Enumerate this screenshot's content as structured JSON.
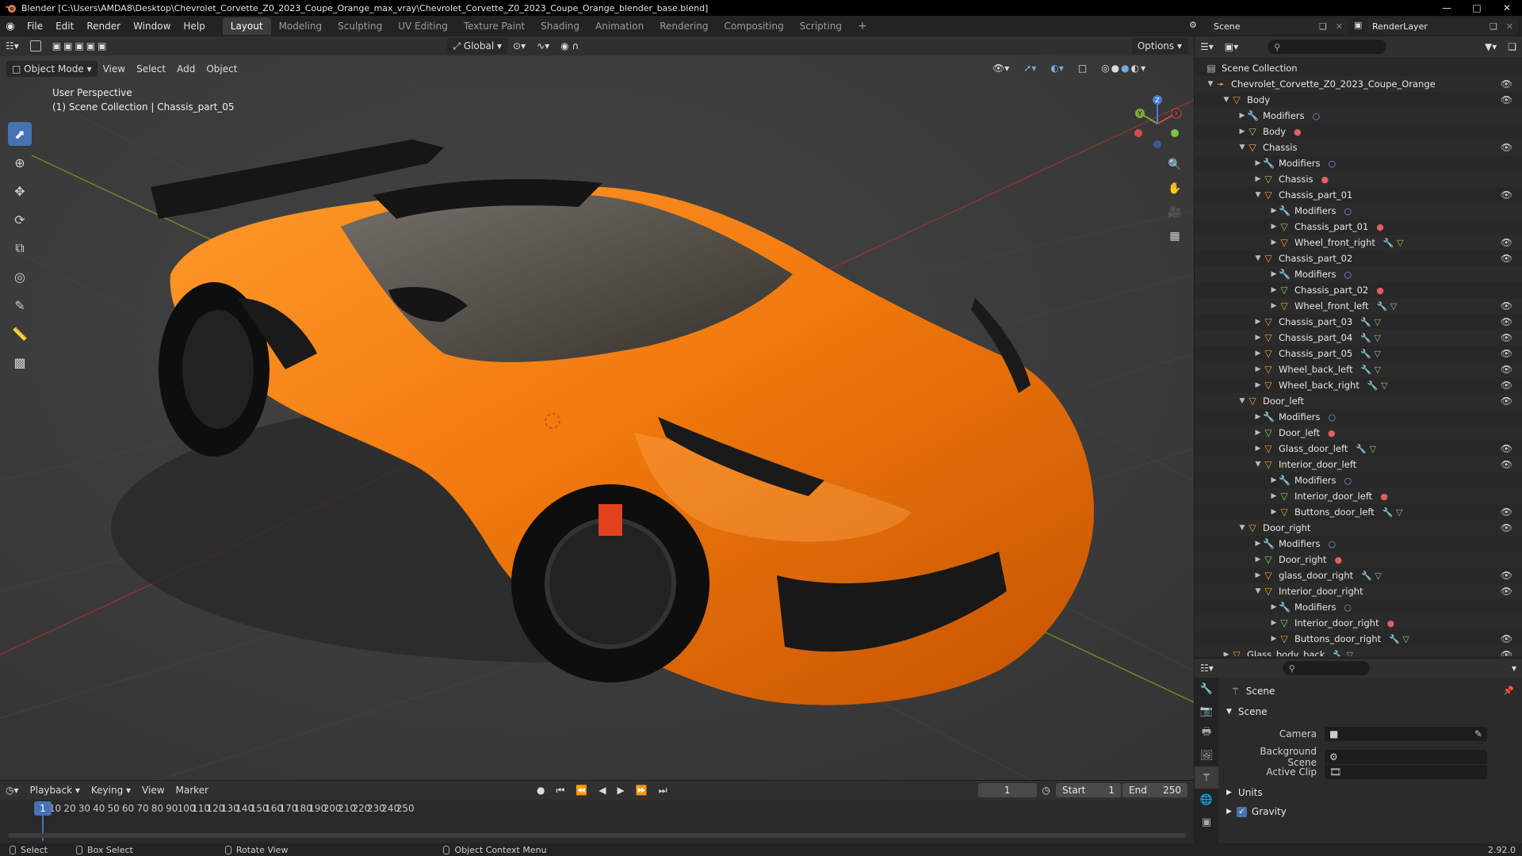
{
  "window": {
    "title": "Blender [C:\\Users\\AMDA8\\Desktop\\Chevrolet_Corvette_Z0_2023_Coupe_Orange_max_vray\\Chevrolet_Corvette_Z0_2023_Coupe_Orange_blender_base.blend]",
    "min_icon": "minimize-icon",
    "max_icon": "maximize-icon",
    "close_icon": "close-icon"
  },
  "menubar": {
    "items": [
      "File",
      "Edit",
      "Render",
      "Window",
      "Help"
    ]
  },
  "workspaces": [
    "Layout",
    "Modeling",
    "Sculpting",
    "UV Editing",
    "Texture Paint",
    "Shading",
    "Animation",
    "Rendering",
    "Compositing",
    "Scripting"
  ],
  "active_workspace": "Layout",
  "scene_selector": "Scene",
  "render_layer": "RenderLayer",
  "viewport": {
    "transform_orientation": "Global",
    "options_label": "Options",
    "mode": "Object Mode",
    "menus": [
      "View",
      "Select",
      "Add",
      "Object"
    ],
    "perspective_label": "User Perspective",
    "collection_label": "(1) Scene Collection | Chassis_part_05",
    "gizmo_axes": [
      "X",
      "Y",
      "Z"
    ]
  },
  "outliner": {
    "root": "Scene Collection",
    "rows": [
      {
        "label": "Chevrolet_Corvette_Z0_2023_Coupe_Orange",
        "depth": 0,
        "arrow": "down",
        "icon": "empty",
        "eye": true
      },
      {
        "label": "Body",
        "depth": 1,
        "arrow": "down",
        "icon": "mesh",
        "eye": true
      },
      {
        "label": "Modifiers",
        "depth": 2,
        "arrow": "right",
        "icon": "wrench",
        "extra": "modifier",
        "eye": false
      },
      {
        "label": "Body",
        "depth": 2,
        "arrow": "right",
        "icon": "meshdata",
        "extra": "material",
        "eye": false
      },
      {
        "label": "Chassis",
        "depth": 2,
        "arrow": "down",
        "icon": "mesh",
        "eye": true
      },
      {
        "label": "Modifiers",
        "depth": 3,
        "arrow": "right",
        "icon": "wrench",
        "extra": "modifier",
        "eye": false
      },
      {
        "label": "Chassis",
        "depth": 3,
        "arrow": "right",
        "icon": "meshdata",
        "extra": "material",
        "eye": false
      },
      {
        "label": "Chassis_part_01",
        "depth": 3,
        "arrow": "down",
        "icon": "mesh",
        "eye": true
      },
      {
        "label": "Modifiers",
        "depth": 4,
        "arrow": "right",
        "icon": "wrench",
        "extra": "modifier",
        "eye": false
      },
      {
        "label": "Chassis_part_01",
        "depth": 4,
        "arrow": "right",
        "icon": "meshdata",
        "extra": "material",
        "eye": false
      },
      {
        "label": "Wheel_front_right",
        "depth": 4,
        "arrow": "right",
        "icon": "mesh",
        "extra": "both",
        "eye": true
      },
      {
        "label": "Chassis_part_02",
        "depth": 3,
        "arrow": "down",
        "icon": "mesh",
        "eye": true
      },
      {
        "label": "Modifiers",
        "depth": 4,
        "arrow": "right",
        "icon": "wrench",
        "extra": "modifier",
        "eye": false
      },
      {
        "label": "Chassis_part_02",
        "depth": 4,
        "arrow": "right",
        "icon": "meshdata",
        "extra": "material",
        "eye": false
      },
      {
        "label": "Wheel_front_left",
        "depth": 4,
        "arrow": "right",
        "icon": "mesh",
        "extra": "both",
        "eye": true
      },
      {
        "label": "Chassis_part_03",
        "depth": 3,
        "arrow": "right",
        "icon": "mesh",
        "extra": "both",
        "eye": true
      },
      {
        "label": "Chassis_part_04",
        "depth": 3,
        "arrow": "right",
        "icon": "mesh",
        "extra": "both",
        "eye": true
      },
      {
        "label": "Chassis_part_05",
        "depth": 3,
        "arrow": "right",
        "icon": "mesh",
        "extra": "both",
        "eye": true
      },
      {
        "label": "Wheel_back_left",
        "depth": 3,
        "arrow": "right",
        "icon": "mesh",
        "extra": "both",
        "eye": true
      },
      {
        "label": "Wheel_back_right",
        "depth": 3,
        "arrow": "right",
        "icon": "mesh",
        "extra": "both",
        "eye": true
      },
      {
        "label": "Door_left",
        "depth": 2,
        "arrow": "down",
        "icon": "mesh",
        "eye": true
      },
      {
        "label": "Modifiers",
        "depth": 3,
        "arrow": "right",
        "icon": "wrench",
        "extra": "modifier",
        "eye": false
      },
      {
        "label": "Door_left",
        "depth": 3,
        "arrow": "right",
        "icon": "meshdata",
        "extra": "material",
        "eye": false
      },
      {
        "label": "Glass_door_left",
        "depth": 3,
        "arrow": "right",
        "icon": "mesh",
        "extra": "both",
        "eye": true
      },
      {
        "label": "Interior_door_left",
        "depth": 3,
        "arrow": "down",
        "icon": "mesh",
        "eye": true
      },
      {
        "label": "Modifiers",
        "depth": 4,
        "arrow": "right",
        "icon": "wrench",
        "extra": "modifier",
        "eye": false
      },
      {
        "label": "Interior_door_left",
        "depth": 4,
        "arrow": "right",
        "icon": "meshdata",
        "extra": "material",
        "eye": false
      },
      {
        "label": "Buttons_door_left",
        "depth": 4,
        "arrow": "right",
        "icon": "mesh",
        "extra": "both",
        "eye": true
      },
      {
        "label": "Door_right",
        "depth": 2,
        "arrow": "down",
        "icon": "mesh",
        "eye": true
      },
      {
        "label": "Modifiers",
        "depth": 3,
        "arrow": "right",
        "icon": "wrench",
        "extra": "modifier",
        "eye": false
      },
      {
        "label": "Door_right",
        "depth": 3,
        "arrow": "right",
        "icon": "meshdata",
        "extra": "material",
        "eye": false
      },
      {
        "label": "glass_door_right",
        "depth": 3,
        "arrow": "right",
        "icon": "mesh",
        "extra": "both",
        "eye": true
      },
      {
        "label": "Interior_door_right",
        "depth": 3,
        "arrow": "down",
        "icon": "mesh",
        "eye": true
      },
      {
        "label": "Modifiers",
        "depth": 4,
        "arrow": "right",
        "icon": "wrench",
        "extra": "modifier",
        "eye": false
      },
      {
        "label": "Interior_door_right",
        "depth": 4,
        "arrow": "right",
        "icon": "meshdata",
        "extra": "material",
        "eye": false
      },
      {
        "label": "Buttons_door_right",
        "depth": 4,
        "arrow": "right",
        "icon": "mesh",
        "extra": "both",
        "eye": true
      },
      {
        "label": "Glass_body_back",
        "depth": 1,
        "arrow": "right",
        "icon": "mesh",
        "extra": "both",
        "eye": true
      }
    ]
  },
  "properties": {
    "tab_title": "Scene",
    "panel": "Scene",
    "fields": [
      {
        "label": "Camera",
        "value": ""
      },
      {
        "label": "Background Scene",
        "value": ""
      },
      {
        "label": "Active Clip",
        "value": ""
      }
    ],
    "subpanels": [
      "Units",
      "Gravity"
    ],
    "gravity_checked": true
  },
  "timeline": {
    "menus": [
      "Playback",
      "Keying",
      "View",
      "Marker"
    ],
    "current_frame": "1",
    "start_label": "Start",
    "start": "1",
    "end_label": "End",
    "end": "250",
    "ticks": [
      "10",
      "20",
      "30",
      "40",
      "50",
      "60",
      "70",
      "80",
      "90",
      "100",
      "110",
      "120",
      "130",
      "140",
      "150",
      "160",
      "170",
      "180",
      "190",
      "200",
      "210",
      "220",
      "230",
      "240",
      "250"
    ]
  },
  "statusbar": {
    "items": [
      "Select",
      "Box Select",
      "Rotate View",
      "Object Context Menu"
    ],
    "version": "2.92.0"
  },
  "colors": {
    "accent": "#4772b3",
    "car_orange": "#f07a10"
  }
}
